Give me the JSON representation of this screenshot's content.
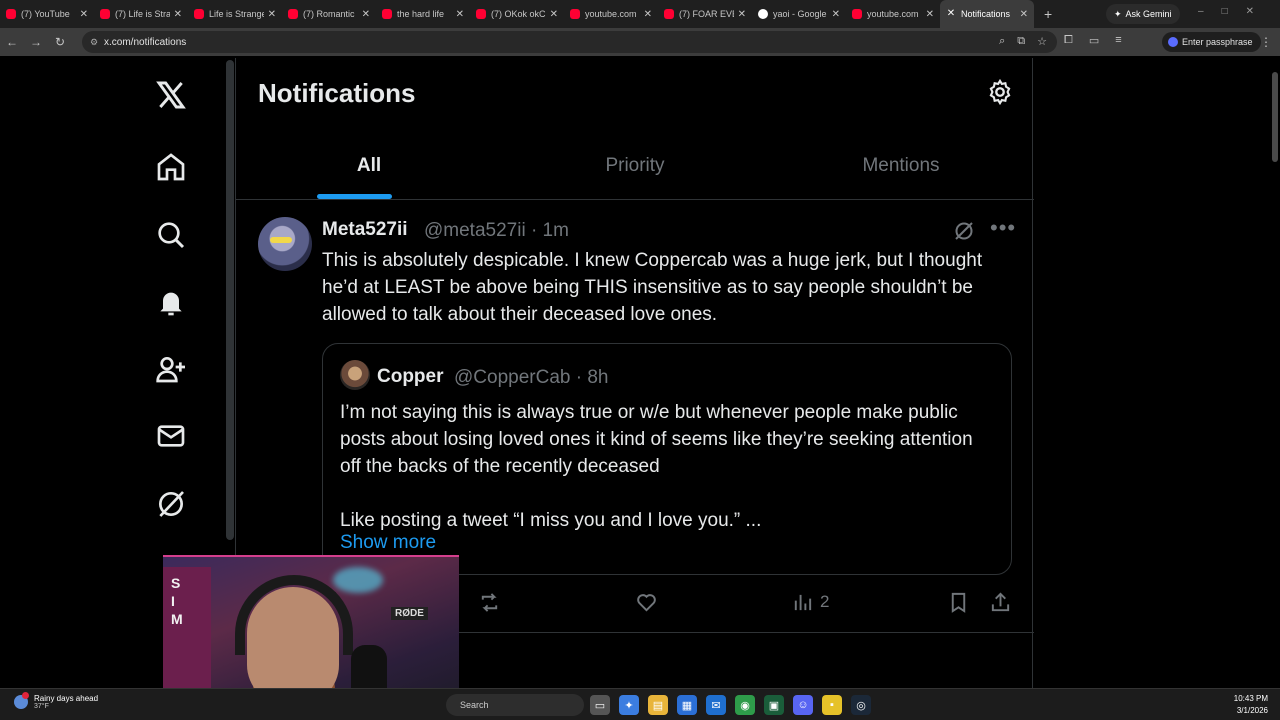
{
  "browser": {
    "tabs": [
      {
        "label": "(7) YouTube",
        "fav": "youtube"
      },
      {
        "label": "(7) Life is Stra",
        "fav": "youtube"
      },
      {
        "label": "Life is Strange",
        "fav": "youtube"
      },
      {
        "label": "(7) Romantic",
        "fav": "youtube"
      },
      {
        "label": "the hard life",
        "fav": "youtube"
      },
      {
        "label": "(7) OKok okC",
        "fav": "youtube"
      },
      {
        "label": "youtube.com",
        "fav": "youtube"
      },
      {
        "label": "(7) FOAR EVE",
        "fav": "youtube"
      },
      {
        "label": "yaoi - Google",
        "fav": "google"
      },
      {
        "label": "youtube.com",
        "fav": "youtube"
      },
      {
        "label": "Notifications",
        "fav": "x"
      }
    ],
    "new_tab": "+",
    "ask_gemini": "Ask Gemini",
    "url": "x.com/notifications",
    "passphrase": "Enter passphrase"
  },
  "page": {
    "title": "Notifications",
    "tabs": [
      "All",
      "Priority",
      "Mentions"
    ],
    "active_tab": "All"
  },
  "post": {
    "name": "Meta527ii",
    "handle": "@meta527ii · 1m",
    "text": "This is absolutely despicable. I knew Coppercab was a huge jerk, but I thought he’d at LEAST be above being THIS insensitive as to say people shouldn’t be allowed to talk about their deceased love ones.",
    "quote": {
      "name": "Copper",
      "handle": "@CopperCab · 8h",
      "line1": "I’m not saying this is always true or w/e but whenever people make public posts about losing loved ones it kind of seems like they’re seeking attention off the backs of the recently deceased",
      "line2": "Like posting a tweet “I miss you and I love you.” ...",
      "show_more": "Show more"
    },
    "views": "2"
  },
  "taskbar": {
    "weather_title": "Rainy days ahead",
    "weather_temp": "37°F",
    "search": "Search",
    "time": "10:43 PM",
    "date": "3/1/2026"
  },
  "webcam": {
    "sign_letters": [
      "S",
      "I",
      "M"
    ],
    "mic_brand": "RØDE"
  },
  "colors": {
    "accent": "#1d9bf0",
    "background": "#000000",
    "muted_text": "#71767b",
    "border": "#2f3336"
  }
}
